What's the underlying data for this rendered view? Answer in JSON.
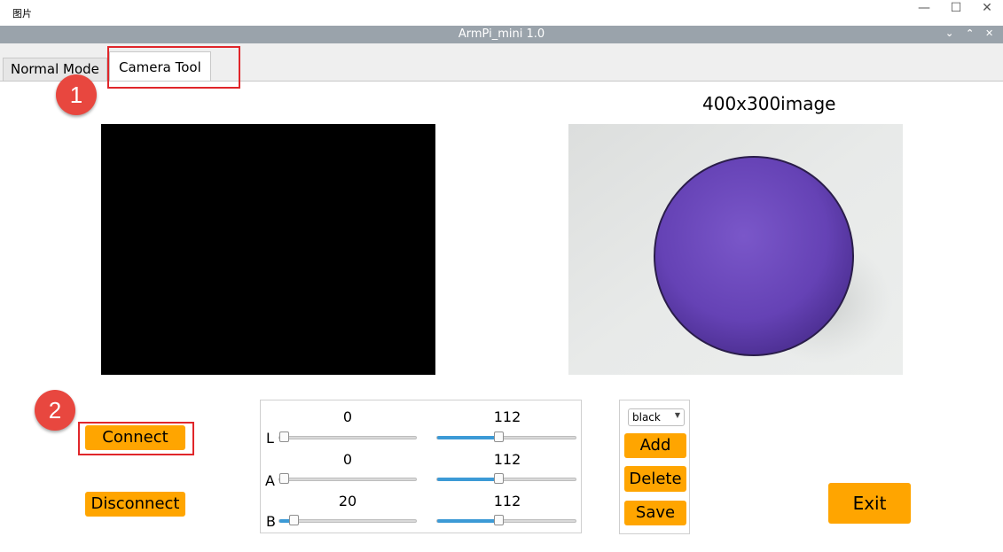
{
  "outer_window": {
    "title": "图片",
    "controls": {
      "minimize": "—",
      "maximize": "☐",
      "close": "✕"
    }
  },
  "app": {
    "title": "ArmPi_mini 1.0",
    "title_controls": {
      "menu": "⌄",
      "up": "⌃",
      "close": "✕"
    }
  },
  "tabs": [
    {
      "label": "Normal Mode",
      "active": false
    },
    {
      "label": "Camera Tool",
      "active": true
    }
  ],
  "annotations": {
    "badge_1": "1",
    "badge_2": "2"
  },
  "image_panel": {
    "title": "400x300image"
  },
  "buttons": {
    "connect": "Connect",
    "disconnect": "Disconnect",
    "add": "Add",
    "delete": "Delete",
    "save": "Save",
    "exit": "Exit"
  },
  "lab_sliders": {
    "min_max_range": [
      0,
      255
    ],
    "rows": [
      {
        "axis": "L",
        "min_value": "0",
        "max_value": "112"
      },
      {
        "axis": "A",
        "min_value": "0",
        "max_value": "112"
      },
      {
        "axis": "B",
        "min_value": "20",
        "max_value": "112"
      }
    ]
  },
  "color_select": {
    "value": "black"
  },
  "colors": {
    "accent": "#ffa500",
    "highlight": "#e0262a",
    "slider_fill": "#3c9ad6",
    "titlebar": "#9aa3ab"
  }
}
